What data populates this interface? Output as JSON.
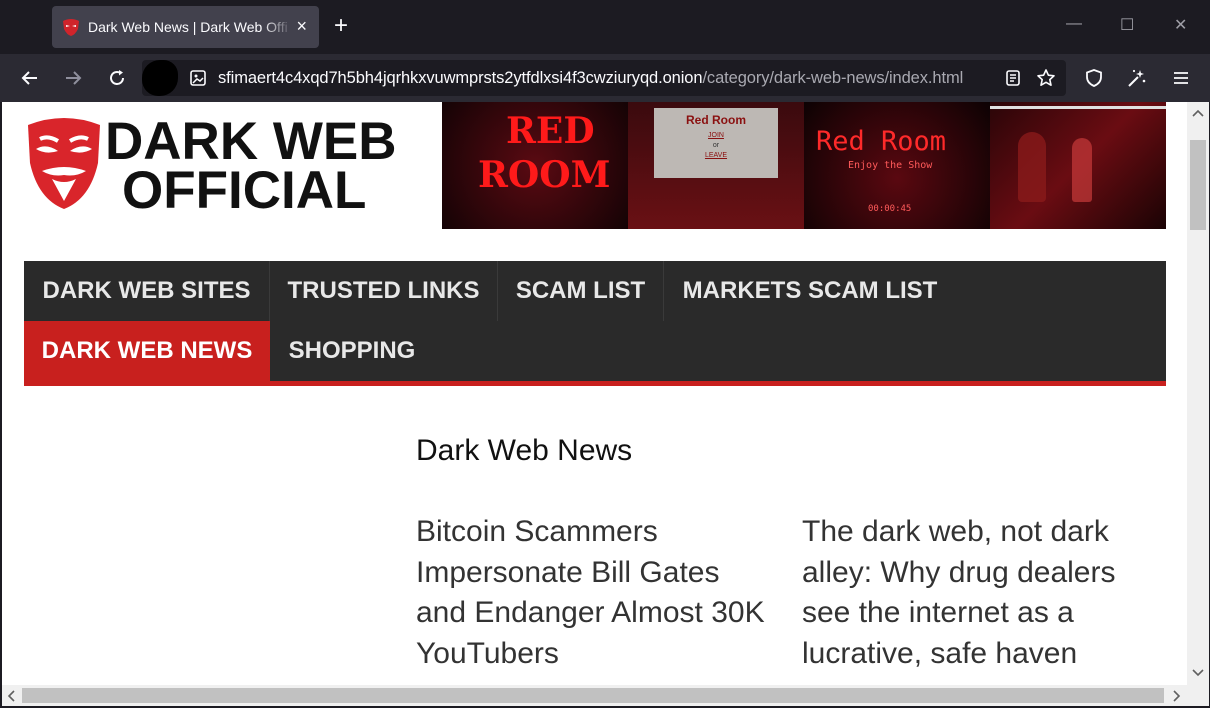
{
  "browser": {
    "tab_title": "Dark Web News | Dark Web Offi",
    "tab_close": "×",
    "new_tab": "+",
    "url_host": "sfimaert4c4xqd7h5bh4jqrhkxvuwmprsts2ytfdlxsi4f3cwziuryqd.onion",
    "url_path": "/category/dark-web-news/index.html",
    "window_controls": {
      "minimize": "—",
      "maximize": "☐",
      "close": "✕"
    }
  },
  "site": {
    "logo_line1": "DARK WEB",
    "logo_line2": "OFFICIAL",
    "banner": {
      "panel1_line1": "RED",
      "panel1_line2": "ROOM",
      "panel2_title": "Red Room",
      "panel2_join": "JOIN",
      "panel2_or": "or",
      "panel2_leave": "LEAVE",
      "panel3_title": "Red Room",
      "panel3_sub": "Enjoy the Show",
      "panel3_time": "00:00:45"
    },
    "nav": {
      "dark_web_sites": "DARK WEB SITES",
      "trusted_links": "TRUSTED LINKS",
      "scam_list": "SCAM LIST",
      "markets_scam_list": "MARKETS SCAM LIST",
      "dark_web_news": "DARK WEB NEWS",
      "shopping": "SHOPPING"
    },
    "page_heading": "Dark Web News",
    "articles": [
      {
        "title": "Bitcoin Scammers Impersonate Bill Gates and Endanger Almost 30K YouTubers"
      },
      {
        "title": "The dark web, not dark alley: Why drug dealers see the internet as a lucrative, safe haven"
      }
    ]
  },
  "colors": {
    "accent_red": "#c8201e",
    "nav_bg": "#2a2a2a",
    "browser_dark": "#1c1b22",
    "toolbar": "#2b2a33"
  },
  "icons": [
    "back-icon",
    "forward-icon",
    "reload-icon",
    "page-icon",
    "reader-view-icon",
    "bookmark-star-icon",
    "shield-icon",
    "extensions-icon",
    "menu-icon"
  ]
}
